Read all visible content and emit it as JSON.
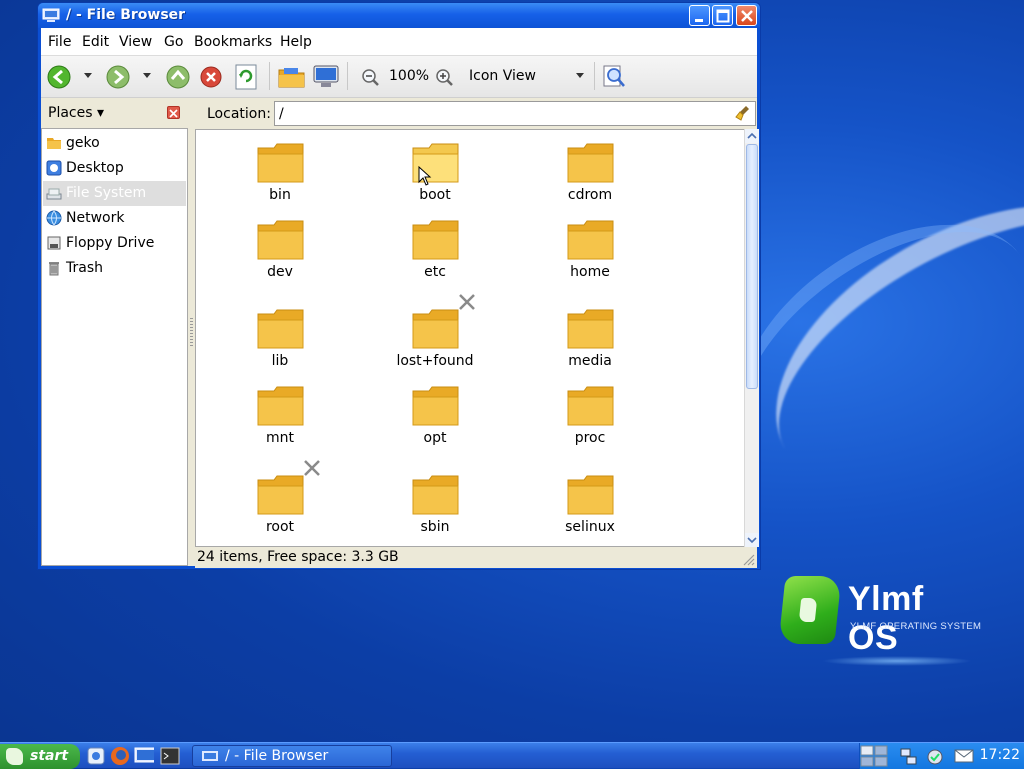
{
  "desktop": {
    "logo_title": "Ylmf OS",
    "logo_subtitle": "YLMF OPERATING SYSTEM"
  },
  "window": {
    "title": "/ - File Browser"
  },
  "menubar": {
    "items": [
      "File",
      "Edit",
      "View",
      "Go",
      "Bookmarks",
      "Help"
    ]
  },
  "toolbar": {
    "zoom_level": "100%",
    "view_mode": "Icon View"
  },
  "sidebar": {
    "header": "Places",
    "items": [
      {
        "label": "geko",
        "icon": "home-folder-icon"
      },
      {
        "label": "Desktop",
        "icon": "desktop-icon"
      },
      {
        "label": "File System",
        "icon": "drive-icon",
        "selected": true
      },
      {
        "label": "Network",
        "icon": "network-icon"
      },
      {
        "label": "Floppy Drive",
        "icon": "floppy-icon"
      },
      {
        "label": "Trash",
        "icon": "trash-icon"
      }
    ]
  },
  "location": {
    "label": "Location:",
    "value": "/"
  },
  "files": [
    {
      "name": "bin"
    },
    {
      "name": "boot"
    },
    {
      "name": "cdrom"
    },
    {
      "name": "dev"
    },
    {
      "name": "etc"
    },
    {
      "name": "home"
    },
    {
      "name": "lib"
    },
    {
      "name": "lost+found",
      "emblem": "no-access"
    },
    {
      "name": "media"
    },
    {
      "name": "mnt"
    },
    {
      "name": "opt"
    },
    {
      "name": "proc"
    },
    {
      "name": "root",
      "emblem": "no-access"
    },
    {
      "name": "sbin"
    },
    {
      "name": "selinux"
    }
  ],
  "status": {
    "text": "24 items, Free space: 3.3 GB"
  },
  "taskbar": {
    "start_label": "start",
    "task_label": "/ - File Browser",
    "clock": "17:22"
  },
  "colors": {
    "titlebar": "#0d53d6",
    "desktop": "#1553c7",
    "folder": "#f2bd3a",
    "start": "#3aa83a"
  }
}
